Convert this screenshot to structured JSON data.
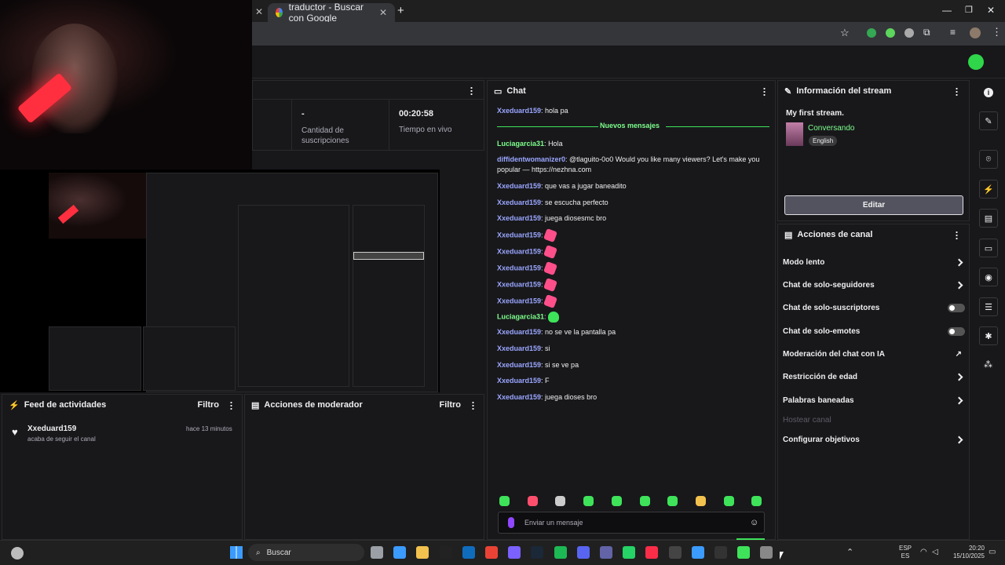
{
  "browser": {
    "tab_title": "traductor - Buscar con Google",
    "new_tab": "+"
  },
  "stats": {
    "subs_value": "-",
    "subs_label": "Cantidad de suscripciones",
    "live_value": "00:20:58",
    "live_label": "Tiempo en vivo"
  },
  "chat": {
    "title": "Chat",
    "new_messages": "Nuevos mensajes",
    "messages": [
      {
        "user": "Xxeduard159",
        "text": "hola pa"
      },
      {
        "user": "Luciagarcia31",
        "text": "Hola"
      },
      {
        "user": "diffidentwomanizer0",
        "text": "@tlaguito-0o0 Would you like many viewers? Let's make you popular — https://nezhna.com"
      },
      {
        "user": "Xxeduard159",
        "text": "que vas a jugar baneadito"
      },
      {
        "user": "Xxeduard159",
        "text": "se escucha perfecto"
      },
      {
        "user": "Xxeduard159",
        "text": "juega diosesmc bro"
      },
      {
        "user": "Xxeduard159",
        "text": ""
      },
      {
        "user": "Xxeduard159",
        "text": ""
      },
      {
        "user": "Xxeduard159",
        "text": ""
      },
      {
        "user": "Xxeduard159",
        "text": ""
      },
      {
        "user": "Xxeduard159",
        "text": ""
      },
      {
        "user": "Luciagarcia31",
        "text": ""
      },
      {
        "user": "Xxeduard159",
        "text": "no se ve la pantalla pa"
      },
      {
        "user": "Xxeduard159",
        "text": "si"
      },
      {
        "user": "Xxeduard159",
        "text": "si se ve pa"
      },
      {
        "user": "Xxeduard159",
        "text": "F"
      },
      {
        "user": "Xxeduard159",
        "text": "juega dioses bro"
      }
    ],
    "input_placeholder": "Enviar un mensaje"
  },
  "stream_info": {
    "title": "Información del stream",
    "stream_title": "My first stream.",
    "category": "Conversando",
    "tag": "English",
    "edit_label": "Editar"
  },
  "channel_actions": {
    "title": "Acciones de canal",
    "items": [
      "Modo lento",
      "Chat de solo-seguidores",
      "Chat de solo-suscriptores",
      "Chat de solo-emotes",
      "Moderación del chat con IA",
      "Restricción de edad",
      "Palabras baneadas",
      "Hostear canal",
      "Configurar objetivos"
    ]
  },
  "activity_feed": {
    "title": "Feed de actividades",
    "filter": "Filtro",
    "event_user": "Xxeduard159",
    "event_text": "acaba de seguir el canal",
    "event_time": "hace 13 minutos"
  },
  "mod_actions": {
    "title": "Acciones de moderador",
    "filter": "Filtro"
  },
  "taskbar": {
    "search": "Buscar",
    "lang_top": "ESP",
    "lang_bottom": "ES",
    "time": "20:20",
    "date": "15/10/2025"
  },
  "colors": {
    "accent_green": "#7dff8c",
    "username_blue": "#9aa6ff",
    "background": "#18181b"
  }
}
